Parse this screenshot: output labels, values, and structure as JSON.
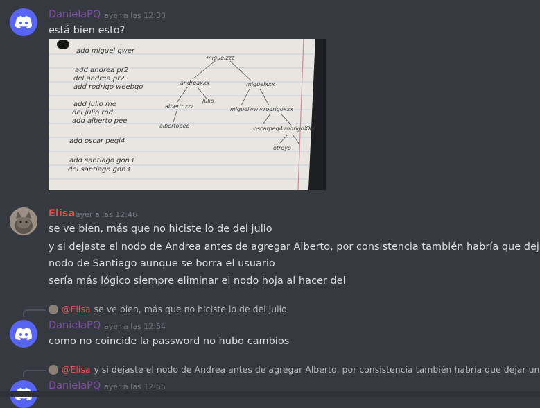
{
  "messages": [
    {
      "author": "DanielaPQ",
      "timestamp": "ayer a las 12:30",
      "lines": [
        "está bien esto?"
      ]
    },
    {
      "author": "Elisa",
      "timestamp": "ayer a las 12:46",
      "lines": [
        "se ve bien, más que no hiciste lo de del julio",
        "y si dejaste el nodo de Andrea antes de agregar Alberto, por consistencia también habría que dejar un",
        "nodo de Santiago aunque se borra el usuario",
        "sería más lógico siempre eliminar el nodo hoja al hacer del"
      ]
    },
    {
      "reply_to": {
        "mention": "@Elisa",
        "text": "se ve bien, más que no hiciste lo de del julio"
      },
      "author": "DanielaPQ",
      "timestamp": "ayer a las 12:54",
      "lines": [
        "como no coincide la password no hubo cambios"
      ]
    },
    {
      "reply_to": {
        "mention": "@Elisa",
        "text": "y si dejaste el nodo de Andrea antes de agregar Alberto, por consistencia también habría que dejar un n…"
      },
      "author": "DanielaPQ",
      "timestamp": "ayer a las 12:55",
      "lines": []
    }
  ],
  "attachment": {
    "icon": "photo-of-handwritten-notes",
    "left_list": [
      "add  miguel  qwer",
      "add  andrea  pr2",
      "del  andrea  pr2",
      "add  rodrigo  weebgo",
      "add  julio  me",
      "del  julio  rod",
      "add  alberto  pee",
      "add  oscar  peqi4",
      "add  santiago  gon3",
      "del  santiago  gon3"
    ],
    "tree_nodes": [
      "miguelzzz",
      "andreaxxx",
      "miguelxxx",
      "albertozzz",
      "julio",
      "miguelwww",
      "rodrigoxxx",
      "albertopee",
      "oscarpeq4",
      "rodrigoXXX",
      "otroyo"
    ]
  },
  "colors": {
    "background": "#36393f",
    "daniela": "#7e4ea8",
    "elisa": "#e8504d",
    "timestamp": "#72767d",
    "text": "#dcddde",
    "discord_blurple": "#5865f2"
  }
}
